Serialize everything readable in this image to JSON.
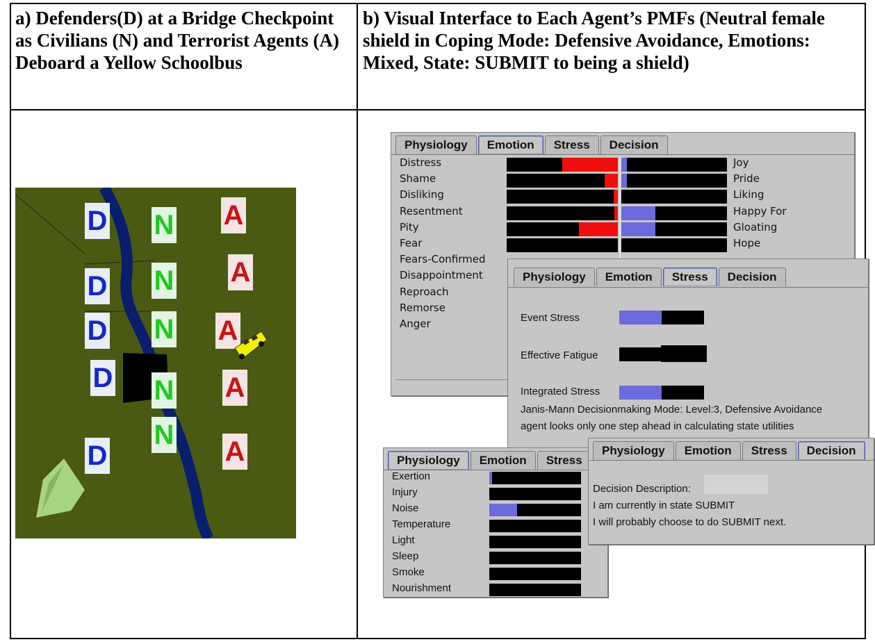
{
  "captions": {
    "left": "a) Defenders(D) at a Bridge Checkpoint as Civilians (N) and Terrorist Agents (A) Deboard a Yellow Schoolbus",
    "right": "b) Visual Interface to Each Agent’s PMFs (Neutral female shield in Coping Mode: Defensive Avoidance, Emotions: Mixed, State: SUBMIT to being a shield)"
  },
  "map": {
    "defender_letter": "D",
    "civilian_letter": "N",
    "terrorist_letter": "A"
  },
  "tabs": [
    "Physiology",
    "Emotion",
    "Stress",
    "Decision"
  ],
  "emotion_panel": {
    "left_labels": [
      "Distress",
      "Shame",
      "Disliking",
      "Resentment",
      "Pity",
      "Fear",
      "Fears-Confirmed",
      "Disappointment",
      "Reproach",
      "Remorse",
      "Anger"
    ],
    "right_labels": [
      "Joy",
      "Pride",
      "Liking",
      "Happy For",
      "Gloating",
      "Hope"
    ],
    "left_red_fraction": [
      0.5,
      0.12,
      0.04,
      0.03,
      0.35,
      0
    ],
    "right_blue_fraction": [
      0.04,
      0.04,
      0,
      0.26,
      0.26,
      0
    ]
  },
  "stress_panel": {
    "rows": [
      {
        "label": "Event Stress",
        "fill": 0.5
      },
      {
        "label": "Effective Fatigue",
        "fill": 0
      },
      {
        "label": "Integrated Stress",
        "fill": 0.5
      }
    ],
    "line1": "Janis-Mann Decisionmaking Mode: Level:3, Defensive Avoidance",
    "line2": "agent looks only one step ahead in calculating state utilities"
  },
  "physiology_panel": {
    "labels": [
      "Exertion",
      "Injury",
      "Noise",
      "Temperature",
      "Light",
      "Sleep",
      "Smoke",
      "Nourishment"
    ],
    "blue_fraction": [
      0.03,
      0,
      0.3,
      0,
      0,
      0,
      0,
      0
    ]
  },
  "decision_panel": {
    "line1": "Decision Description:",
    "line2": "I am currently in state  SUBMIT",
    "line3": "I will probably choose to do SUBMIT next."
  },
  "colors": {
    "map_bg": "#4a5a12",
    "river": "#0a1e6e",
    "bus": "#f0f000",
    "panel": "#c6c6c6",
    "red_bar": "#ef0f0f",
    "blue_bar": "#6b6bdb"
  }
}
